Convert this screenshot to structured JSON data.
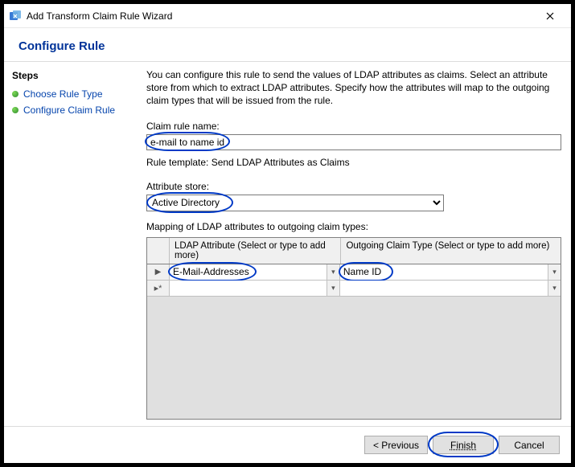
{
  "window": {
    "title": "Add Transform Claim Rule Wizard"
  },
  "header": {
    "title": "Configure Rule"
  },
  "sidebar": {
    "title": "Steps",
    "items": [
      {
        "label": "Choose Rule Type"
      },
      {
        "label": "Configure Claim Rule"
      }
    ]
  },
  "main": {
    "instruction": "You can configure this rule to send the values of LDAP attributes as claims. Select an attribute store from which to extract LDAP attributes. Specify how the attributes will map to the outgoing claim types that will be issued from the rule.",
    "claim_rule_name_label": "Claim rule name:",
    "claim_rule_name_value": "e-mail to name id",
    "rule_template_label": "Rule template: Send LDAP Attributes as Claims",
    "attribute_store_label": "Attribute store:",
    "attribute_store_value": "Active Directory",
    "mapping_label": "Mapping of LDAP attributes to outgoing claim types:",
    "grid": {
      "col1": "LDAP Attribute (Select or type to add more)",
      "col2": "Outgoing Claim Type (Select or type to add more)",
      "rows": [
        {
          "ldap": "E-Mail-Addresses",
          "claim": "Name ID"
        },
        {
          "ldap": "",
          "claim": ""
        }
      ]
    }
  },
  "footer": {
    "previous": "< Previous",
    "finish": "Finish",
    "cancel": "Cancel"
  }
}
